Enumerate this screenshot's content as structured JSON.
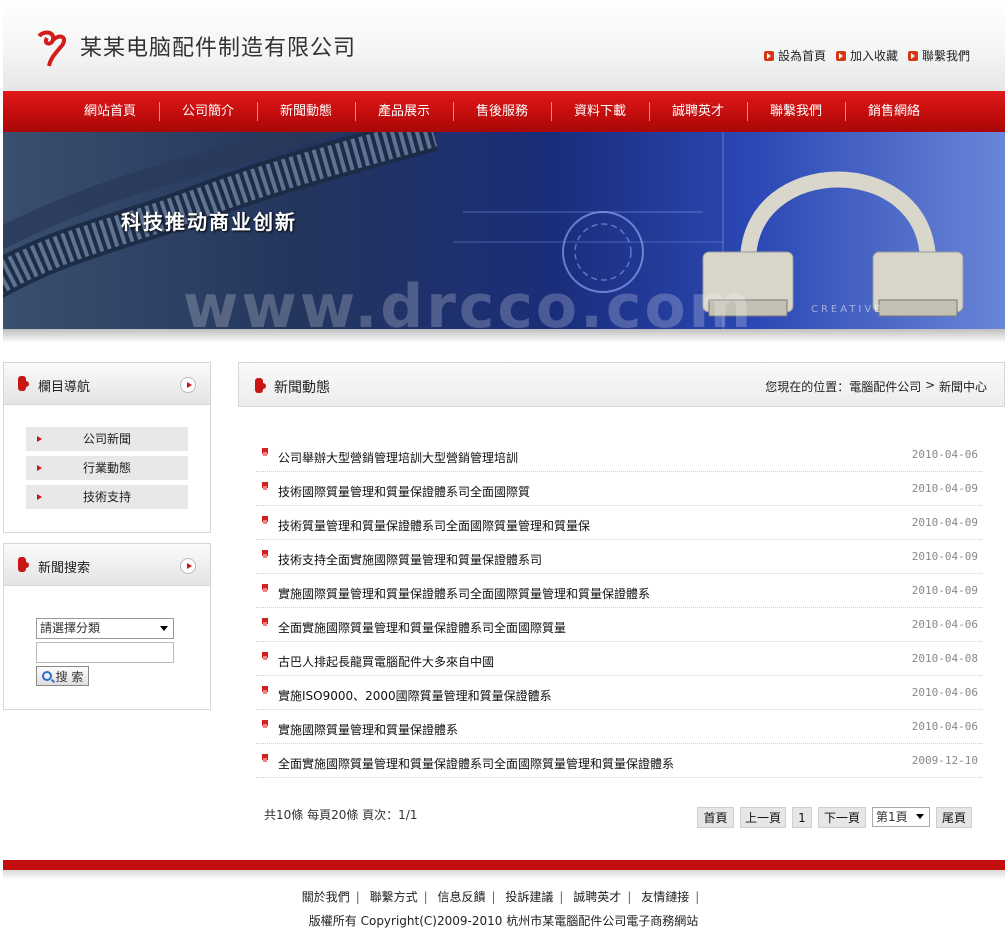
{
  "header": {
    "company_name": "某某电脑配件制造有限公司",
    "top_links": [
      {
        "label": "設為首頁"
      },
      {
        "label": "加入收藏"
      },
      {
        "label": "聯繫我們"
      }
    ]
  },
  "nav": [
    "網站首頁",
    "公司簡介",
    "新聞動態",
    "產品展示",
    "售後服務",
    "資料下載",
    "誠聘英才",
    "聯繫我們",
    "銷售網絡"
  ],
  "banner": {
    "slogan": "科技推动商业创新",
    "watermark": "www.drcco.com",
    "product_label": "CREATIVE"
  },
  "sidebar": {
    "category_title": "欄目導航",
    "categories": [
      "公司新聞",
      "行業動態",
      "技術支持"
    ],
    "search_title": "新聞搜索",
    "select_value": "請選擇分類",
    "search_button": "搜 索"
  },
  "main": {
    "title": "新聞動態",
    "breadcrumb_prefix": "您現在的位置：",
    "breadcrumb_home": "電腦配件公司",
    "breadcrumb_sep": " > ",
    "breadcrumb_current": "新聞中心",
    "news": [
      {
        "title": "公司舉辦大型營銷管理培訓大型營銷管理培訓",
        "date": "2010-04-06"
      },
      {
        "title": "技術國際質量管理和質量保證體系司全面國際質",
        "date": "2010-04-09"
      },
      {
        "title": "技術質量管理和質量保證體系司全面國際質量管理和質量保",
        "date": "2010-04-09"
      },
      {
        "title": "技術支持全面實施國際質量管理和質量保證體系司",
        "date": "2010-04-09"
      },
      {
        "title": "實施國際質量管理和質量保證體系司全面國際質量管理和質量保證體系",
        "date": "2010-04-09"
      },
      {
        "title": "全面實施國際質量管理和質量保證體系司全面國際質量",
        "date": "2010-04-06"
      },
      {
        "title": "古巴人排起長龍買電腦配件大多來自中國",
        "date": "2010-04-08"
      },
      {
        "title": "實施ISO9000、2000國際質量管理和質量保證體系",
        "date": "2010-04-06"
      },
      {
        "title": "實施國際質量管理和質量保證體系",
        "date": "2010-04-06"
      },
      {
        "title": "全面實施國際質量管理和質量保證體系司全面國際質量管理和質量保證體系",
        "date": "2009-12-10"
      }
    ],
    "pager": {
      "info": "共10條 每頁20條 頁次：1/1",
      "first": "首頁",
      "prev": "上一頁",
      "current": "1",
      "next": "下一頁",
      "page_select": "第1頁",
      "last": "尾頁"
    }
  },
  "footer": {
    "links": [
      "關於我們",
      "聯繫方式",
      "信息反饋",
      "投訴建議",
      "誠聘英才",
      "友情鏈接"
    ],
    "separator": "|",
    "copyright": "版權所有 Copyright(C)2009-2010 杭州市某電腦配件公司電子商務網站"
  },
  "colors": {
    "brand_red": "#c40d0d",
    "accent_red": "#d23a12"
  }
}
